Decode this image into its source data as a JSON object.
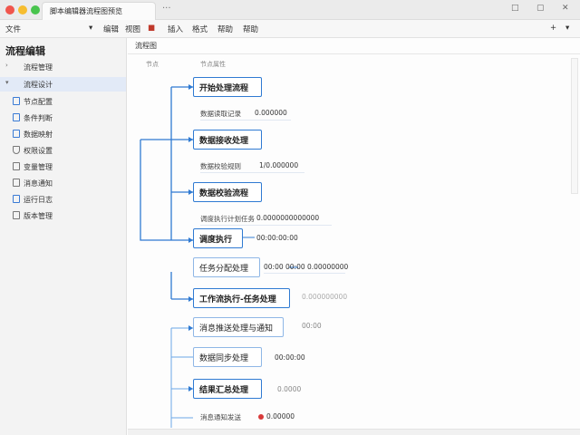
{
  "window": {
    "tab_title": "脚本编辑器流程图预览",
    "more": "···",
    "min": "□",
    "max": "▢",
    "close": "✕"
  },
  "toolbar": {
    "left_label": "文件",
    "caret": "▾",
    "items": [
      "编辑",
      "视图",
      "■",
      "插入",
      "格式",
      "帮助"
    ],
    "right_a": "+",
    "right_b": "▾"
  },
  "sidebar": {
    "title": "流程编辑",
    "items": [
      {
        "label": "流程管理",
        "icon": "chevron-right-icon",
        "active": false
      },
      {
        "label": "流程设计",
        "icon": "chevron-down-icon",
        "active": true
      },
      {
        "label": "节点配置",
        "icon": "doc-icon",
        "active": false
      },
      {
        "label": "条件判断",
        "icon": "doc-icon",
        "active": false
      },
      {
        "label": "数据映射",
        "icon": "doc-icon",
        "active": false
      },
      {
        "label": "权限设置",
        "icon": "shield-icon",
        "active": false
      },
      {
        "label": "变量管理",
        "icon": "doc-icon",
        "active": false
      },
      {
        "label": "消息通知",
        "icon": "doc-icon",
        "active": false
      },
      {
        "label": "运行日志",
        "icon": "doc-icon",
        "active": false
      },
      {
        "label": "版本管理",
        "icon": "doc-icon",
        "active": false
      }
    ]
  },
  "main": {
    "breadcrumb": "流程图",
    "col_a": "节点",
    "col_b": "节点属性",
    "nodes": [
      {
        "label": "开始处理流程"
      },
      {
        "label": "数据接收处理"
      },
      {
        "label": "数据校验流程"
      },
      {
        "label": "调度执行"
      },
      {
        "label": "任务分配处理"
      },
      {
        "label": "工作流执行-任务处理"
      },
      {
        "label": "消息推送处理与通知"
      },
      {
        "label": "数据同步处理"
      },
      {
        "label": "结果汇总处理"
      }
    ],
    "metas": [
      {
        "label": "数据读取记录",
        "value": "0.000000"
      },
      {
        "label": "数据校验规则",
        "value": "1/0.000000"
      },
      {
        "label": "调度执行计划任务",
        "value": "0.0000000000000"
      },
      {
        "label": "",
        "value": "00:00:00:00"
      },
      {
        "label": "",
        "value": "00:00 00:00   0.00000000"
      },
      {
        "label": "",
        "value": "0.000000000"
      },
      {
        "label": "",
        "value": "00:00"
      },
      {
        "label": "",
        "value": "00:00:00"
      },
      {
        "label": "",
        "value": "0.0000"
      },
      {
        "label": "消息通知发送",
        "value": "0.00000"
      }
    ]
  }
}
